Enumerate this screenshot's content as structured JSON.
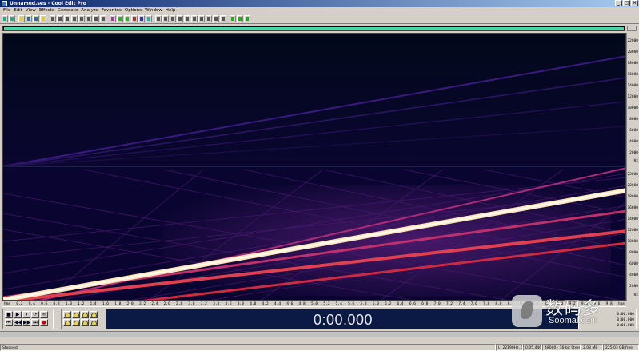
{
  "window": {
    "title": "Unnamed.ses - Cool Edit Pro",
    "buttons": [
      "_",
      "□",
      "×"
    ]
  },
  "menu": [
    "File",
    "Edit",
    "View",
    "Effects",
    "Generate",
    "Analyze",
    "Favorites",
    "Options",
    "Window",
    "Help"
  ],
  "frequency_ruler": {
    "upper_labels": [
      "22000",
      "20000",
      "18000",
      "16000",
      "14000",
      "12000",
      "10000",
      "8000",
      "6000",
      "4000",
      "2000",
      "Hz"
    ],
    "lower_labels": [
      "22000",
      "20000",
      "18000",
      "16000",
      "14000",
      "12000",
      "10000",
      "8000",
      "6000",
      "4000",
      "2000",
      "Hz"
    ]
  },
  "time_ruler": {
    "labels": [
      "hms",
      "0.2",
      "0.4",
      "0.6",
      "0.8",
      "1.0",
      "1.2",
      "1.4",
      "1.6",
      "1.8",
      "2.0",
      "2.2",
      "2.4",
      "2.6",
      "2.8",
      "3.0",
      "3.2",
      "3.4",
      "3.6",
      "3.8",
      "4.0",
      "4.2",
      "4.4",
      "4.6",
      "4.8",
      "5.0",
      "5.2",
      "5.4",
      "5.6",
      "5.8",
      "6.0",
      "6.2",
      "6.4",
      "6.6",
      "6.8",
      "7.0",
      "7.2",
      "7.4",
      "7.6",
      "7.8",
      "8.0",
      "8.2",
      "8.4",
      "8.6",
      "8.8",
      "9.0",
      "9.2",
      "9.4",
      "9.6",
      "9.8",
      "hms"
    ]
  },
  "transport": {
    "row1": [
      "■",
      "▶",
      "⏸",
      "⟳",
      "∞"
    ],
    "row2": [
      "⏮",
      "◀◀",
      "▶▶",
      "⏭",
      "●"
    ]
  },
  "time_display": "0:00.000",
  "selection_panel": [
    "0:00.000",
    "0:00.000",
    "0:00.000"
  ],
  "status": {
    "state": "Stopped",
    "level": "L: 22190Hz, 0.00 dB",
    "time": "0:05.446",
    "format": "48000 · 16-bit Stereo",
    "size": "2.03 MB",
    "free": "225.03 GB free"
  },
  "watermark": {
    "cn": "数码多",
    "en": "Soomal.com"
  },
  "colors": {
    "accent": "#4fd6a8",
    "spectral_bg": "#020a1e",
    "title_bar": "#0a246a"
  }
}
